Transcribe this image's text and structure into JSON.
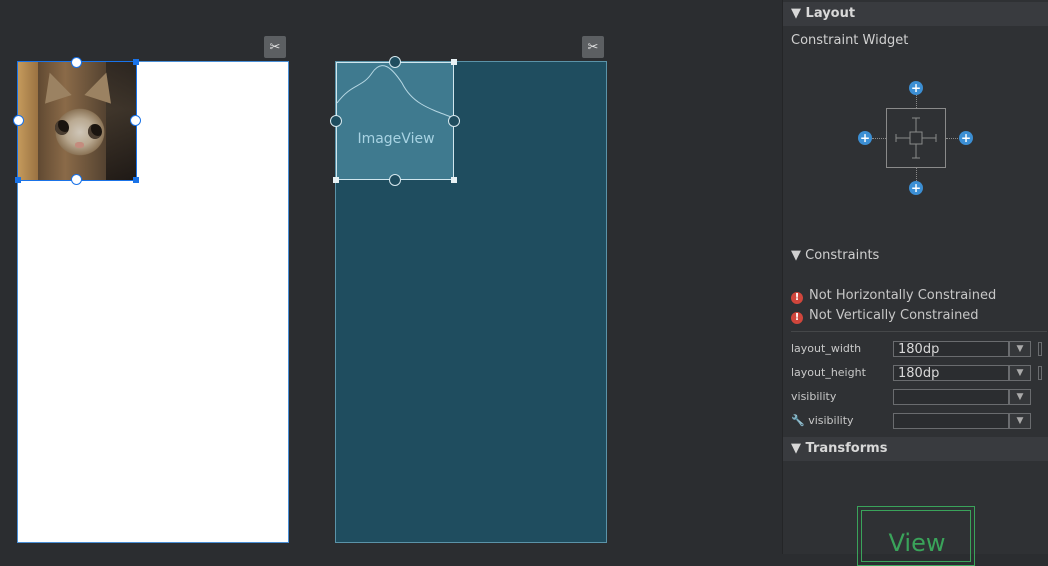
{
  "canvas": {
    "toggle_icon": "magnet-off-icon",
    "blueprint_label": "ImageView"
  },
  "panel": {
    "layout_header": "Layout",
    "constraint_widget_title": "Constraint Widget",
    "constraints_header": "Constraints",
    "warnings": [
      "Not Horizontally Constrained",
      "Not Vertically Constrained"
    ],
    "properties": [
      {
        "label": "layout_width",
        "value": "180dp"
      },
      {
        "label": "layout_height",
        "value": "180dp"
      },
      {
        "label": "visibility",
        "value": ""
      },
      {
        "label": "visibility",
        "value": "",
        "tool_icon": "wrench-icon"
      }
    ],
    "transforms_header": "Transforms",
    "transforms_view_label": "View"
  },
  "colors": {
    "accent": "#1a73e8",
    "blueprint": "#1f4d5f",
    "warning": "#d0463c",
    "plus": "#3c8fd4",
    "transform_view": "#3aa35a"
  }
}
